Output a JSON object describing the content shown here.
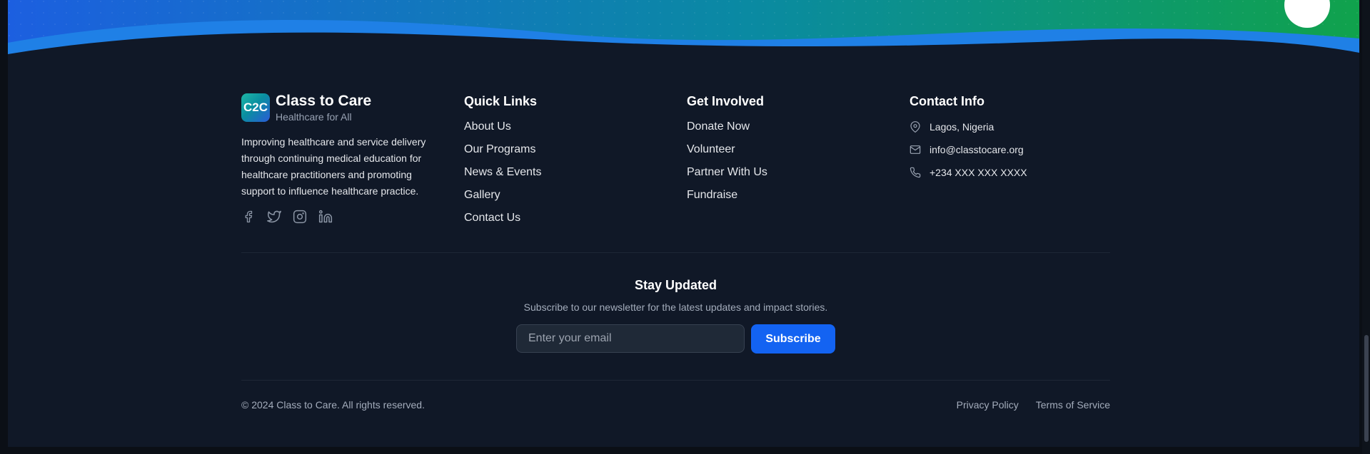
{
  "brand": {
    "logo_text": "C2C",
    "name": "Class to Care",
    "tagline": "Healthcare for All",
    "description": "Improving healthcare and service delivery through continuing medical education for healthcare practitioners and promoting support to influence healthcare practice.",
    "socials": [
      "facebook-icon",
      "twitter-icon",
      "instagram-icon",
      "linkedin-icon"
    ]
  },
  "quick_links": {
    "title": "Quick Links",
    "items": [
      "About Us",
      "Our Programs",
      "News & Events",
      "Gallery",
      "Contact Us"
    ]
  },
  "get_involved": {
    "title": "Get Involved",
    "items": [
      "Donate Now",
      "Volunteer",
      "Partner With Us",
      "Fundraise"
    ]
  },
  "contact": {
    "title": "Contact Info",
    "location": "Lagos, Nigeria",
    "email": "info@classtocare.org",
    "phone": "+234 XXX XXX XXXX"
  },
  "newsletter": {
    "title": "Stay Updated",
    "subtitle": "Subscribe to our newsletter for the latest updates and impact stories.",
    "placeholder": "Enter your email",
    "button": "Subscribe"
  },
  "bottom": {
    "copyright": "© 2024 Class to Care. All rights reserved.",
    "privacy": "Privacy Policy",
    "terms": "Terms of Service"
  },
  "colors": {
    "background": "#101827",
    "accent": "#1363f2",
    "gradient_start": "#1f6fe0",
    "gradient_end": "#10a050"
  }
}
